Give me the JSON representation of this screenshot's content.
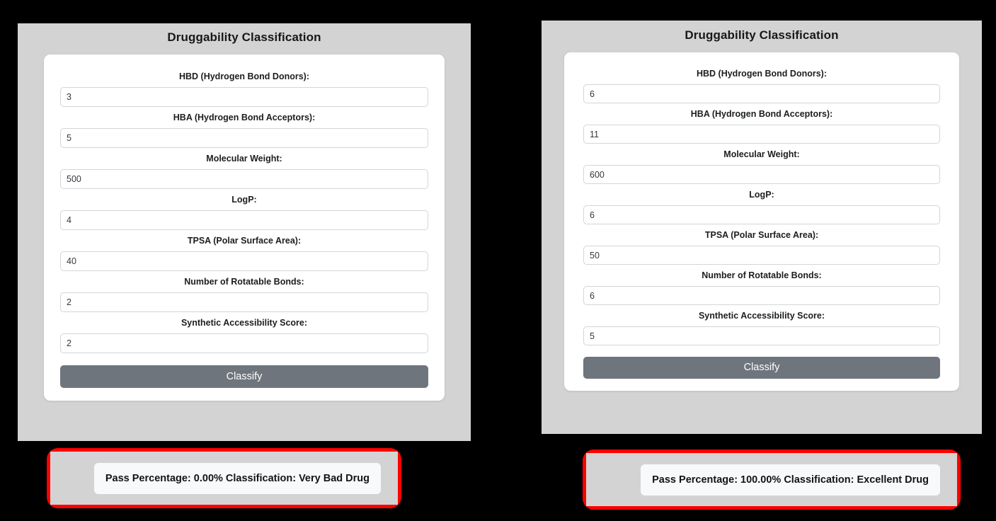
{
  "colors": {
    "panel_background": "#d3d3d3",
    "card_background": "#ffffff",
    "page_background": "#000000",
    "button": "#6e757c",
    "highlight_border": "#ff0000",
    "result_background": "#f8f9fa"
  },
  "panels": [
    {
      "id": "left",
      "title": "Druggability Classification",
      "fields": [
        {
          "label": "HBD (Hydrogen Bond Donors):",
          "value": "3"
        },
        {
          "label": "HBA (Hydrogen Bond Acceptors):",
          "value": "5"
        },
        {
          "label": "Molecular Weight:",
          "value": "500"
        },
        {
          "label": "LogP:",
          "value": "4"
        },
        {
          "label": "TPSA (Polar Surface Area):",
          "value": "40"
        },
        {
          "label": "Number of Rotatable Bonds:",
          "value": "2"
        },
        {
          "label": "Synthetic Accessibility Score:",
          "value": "2"
        }
      ],
      "submit_label": "Classify",
      "result": {
        "text": "Pass Percentage: 0.00% Classification: Very Bad Drug",
        "pass_percentage": "0.00%",
        "classification": "Very Bad Drug"
      }
    },
    {
      "id": "right",
      "title": "Druggability Classification",
      "fields": [
        {
          "label": "HBD (Hydrogen Bond Donors):",
          "value": "6"
        },
        {
          "label": "HBA (Hydrogen Bond Acceptors):",
          "value": "11"
        },
        {
          "label": "Molecular Weight:",
          "value": "600"
        },
        {
          "label": "LogP:",
          "value": "6"
        },
        {
          "label": "TPSA (Polar Surface Area):",
          "value": "50"
        },
        {
          "label": "Number of Rotatable Bonds:",
          "value": "6"
        },
        {
          "label": "Synthetic Accessibility Score:",
          "value": "5"
        }
      ],
      "submit_label": "Classify",
      "result": {
        "text": "Pass Percentage: 100.00% Classification: Excellent Drug",
        "pass_percentage": "100.00%",
        "classification": "Excellent Drug"
      }
    }
  ]
}
